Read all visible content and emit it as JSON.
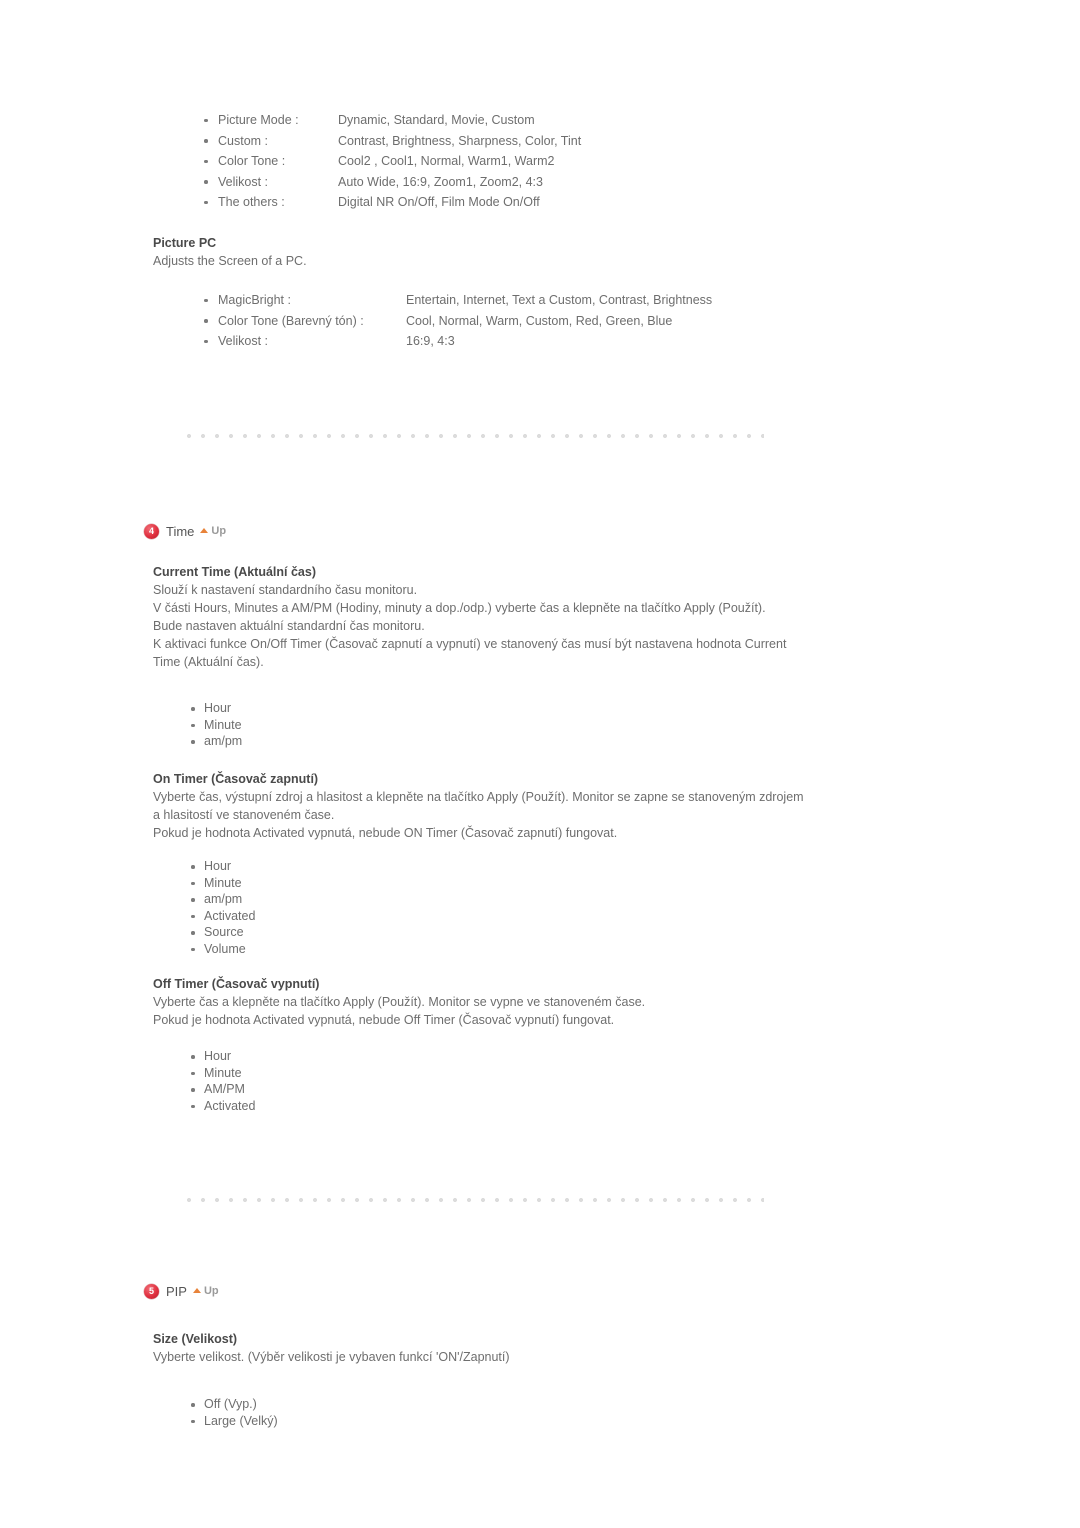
{
  "page": {
    "accent_badge_color": "#d62b38",
    "up_arrow_color": "#e8833a",
    "heading_color": "#4a4a4a",
    "body_color": "#6e6e6e"
  },
  "picture_video_specs": [
    {
      "label": "Picture Mode :",
      "value": "Dynamic, Standard, Movie, Custom"
    },
    {
      "label": "Custom :",
      "value": "Contrast, Brightness, Sharpness, Color, Tint"
    },
    {
      "label": "Color Tone :",
      "value": "Cool2 , Cool1, Normal, Warm1, Warm2"
    },
    {
      "label": "Velikost :",
      "value": "Auto Wide, 16:9, Zoom1, Zoom2, 4:3"
    },
    {
      "label": "The others :",
      "value": "Digital NR On/Off, Film Mode On/Off"
    }
  ],
  "picture_pc": {
    "heading": "Picture PC",
    "description": "Adjusts the Screen of a PC.",
    "specs": [
      {
        "label": "MagicBright :",
        "value": "Entertain, Internet, Text a Custom, Contrast, Brightness"
      },
      {
        "label": "Color Tone (Barevný tón) :",
        "value": "Cool, Normal, Warm, Custom, Red, Green, Blue"
      },
      {
        "label": "Velikost :",
        "value": "16:9, 4:3"
      }
    ]
  },
  "section_time": {
    "badge": "4",
    "title": "Time",
    "up_label": "Up",
    "current_time": {
      "heading": "Current Time (Aktuální čas)",
      "paragraphs": [
        "Slouží k nastavení standardního času monitoru.",
        "V části Hours, Minutes a AM/PM (Hodiny, minuty a dop./odp.) vyberte čas a klepněte na tlačítko Apply (Použít).",
        "Bude nastaven aktuální standardní čas monitoru.",
        "K aktivaci funkce On/Off Timer (Časovač zapnutí a vypnutí) ve stanovený čas musí být nastavena hodnota Current Time (Aktuální čas)."
      ],
      "items": [
        "Hour",
        "Minute",
        "am/pm"
      ]
    },
    "on_timer": {
      "heading": "On Timer (Časovač zapnutí)",
      "paragraphs": [
        "Vyberte čas, výstupní zdroj a hlasitost a klepněte na tlačítko Apply (Použít). Monitor se zapne se stanoveným zdrojem a hlasitostí ve stanoveném čase.",
        "Pokud je hodnota Activated vypnutá, nebude ON Timer (Časovač zapnutí) fungovat."
      ],
      "items": [
        "Hour",
        "Minute",
        "am/pm",
        "Activated",
        "Source",
        "Volume"
      ]
    },
    "off_timer": {
      "heading": "Off Timer (Časovač vypnutí)",
      "paragraphs": [
        "Vyberte čas a klepněte na tlačítko Apply (Použít). Monitor se vypne ve stanoveném čase.",
        "Pokud je hodnota Activated vypnutá, nebude Off Timer (Časovač vypnutí) fungovat."
      ],
      "items": [
        "Hour",
        "Minute",
        "AM/PM",
        "Activated"
      ]
    }
  },
  "section_pip": {
    "badge": "5",
    "title": "PIP",
    "up_label": "Up",
    "size": {
      "heading": "Size (Velikost)",
      "paragraphs": [
        "Vyberte velikost. (Výběr velikosti je vybaven funkcí 'ON'/Zapnutí)"
      ],
      "items": [
        "Off (Vyp.)",
        "Large (Velký)"
      ]
    }
  }
}
